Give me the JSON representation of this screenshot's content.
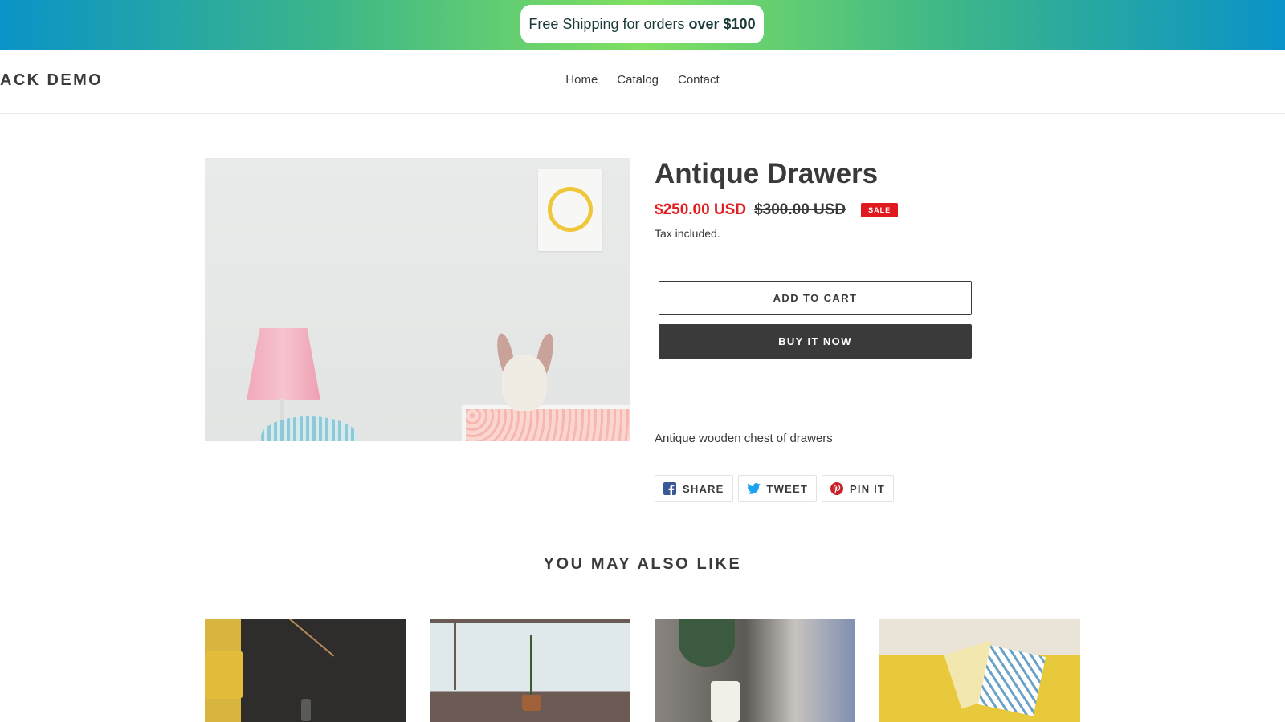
{
  "announcement": {
    "text": "Free Shipping for orders",
    "bold": "over $100"
  },
  "header": {
    "logo": "ACK DEMO",
    "nav": [
      "Home",
      "Catalog",
      "Contact"
    ]
  },
  "product": {
    "title": "Antique Drawers",
    "sale_price": "$250.00 USD",
    "regular_price": "$300.00 USD",
    "badge": "SALE",
    "tax_note": "Tax included.",
    "add_to_cart": "ADD TO CART",
    "buy_now": "BUY IT NOW",
    "description": "Antique wooden chest of drawers"
  },
  "share": {
    "facebook": "SHARE",
    "twitter": "TWEET",
    "pinterest": "PIN IT"
  },
  "related": {
    "heading": "YOU MAY ALSO LIKE"
  },
  "colors": {
    "accent_sale": "#e02020",
    "button_dark": "#3a3a3a",
    "facebook": "#3b5998",
    "twitter": "#1da1f2",
    "pinterest": "#cb2027"
  }
}
